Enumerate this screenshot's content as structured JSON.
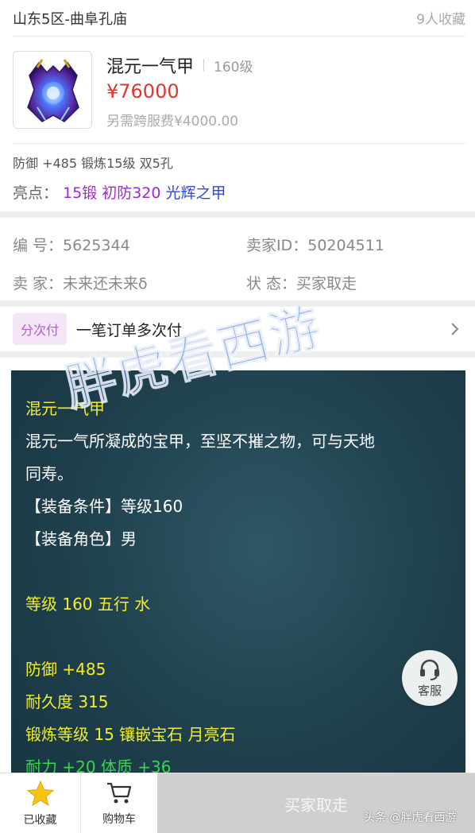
{
  "header": {
    "server": "山东5区-曲阜孔庙",
    "favorites": "9人收藏"
  },
  "item": {
    "name": "混元一气甲",
    "level": "160级",
    "price": "¥76000",
    "cross_server_fee": "另需跨服费¥4000.00",
    "image_icon": "armor-icon"
  },
  "attributes": "防御 +485 锻炼15级 双5孔",
  "highlights": {
    "label": "亮点：",
    "tags": [
      "15锻",
      "初防320",
      "光辉之甲"
    ]
  },
  "info": {
    "id_label": "编  号：",
    "id_value": "5625344",
    "seller_id_label": "卖家ID：",
    "seller_id_value": "50204511",
    "seller_label": "卖  家：",
    "seller_value": "未来还未来δ",
    "status_label": "状  态：",
    "status_value": "买家取走"
  },
  "payment": {
    "badge": "分次付",
    "text": "一笔订单多次付"
  },
  "description": {
    "title": "混元一气甲",
    "text1": "混元一气所凝成的宝甲，至坚不摧之物，可与天地",
    "text2": "同寿。",
    "req_level": "【装备条件】等级160",
    "req_role": "【装备角色】男",
    "level_element": "等级 160 五行 水",
    "defense": "防御 +485",
    "durability": "耐久度 315",
    "refine": "锻炼等级 15 镶嵌宝石 月亮石",
    "bonus": "耐力 +20 体质 +36"
  },
  "watermark": "胖虎看西游",
  "service": {
    "label": "客服"
  },
  "bottom": {
    "favorited": "已收藏",
    "cart": "购物车",
    "buy": "买家取走"
  },
  "credit": "头条 @胖虎看西游",
  "colors": {
    "price": "#e0342f",
    "highlight_purple": "#9b2bd6",
    "highlight_blue": "#3048d8",
    "desc_yellow": "#f2ee2e",
    "desc_green": "#34d84a",
    "star": "#f7c414"
  }
}
